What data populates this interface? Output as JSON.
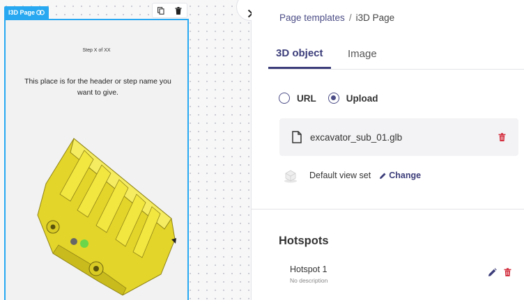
{
  "canvas": {
    "page_tag": "I3D Page",
    "step_text": "Step X of XX",
    "header_text": "This place is for the header or step name you want to give."
  },
  "breadcrumb": {
    "parent": "Page templates",
    "separator": "/",
    "current": "i3D Page"
  },
  "tabs": [
    {
      "label": "3D object",
      "active": true
    },
    {
      "label": "Image",
      "active": false
    }
  ],
  "source": {
    "options": [
      {
        "label": "URL",
        "selected": false
      },
      {
        "label": "Upload",
        "selected": true
      }
    ]
  },
  "file": {
    "name": "excavator_sub_01.glb"
  },
  "view": {
    "label": "Default view set",
    "change_label": "Change"
  },
  "hotspots": {
    "title": "Hotspots",
    "items": [
      {
        "name": "Hotspot 1",
        "description": "No description"
      }
    ]
  },
  "colors": {
    "accent": "#3c3d7a",
    "selection": "#27a8f0",
    "danger": "#d32f3f",
    "model_yellow": "#f2e233"
  }
}
